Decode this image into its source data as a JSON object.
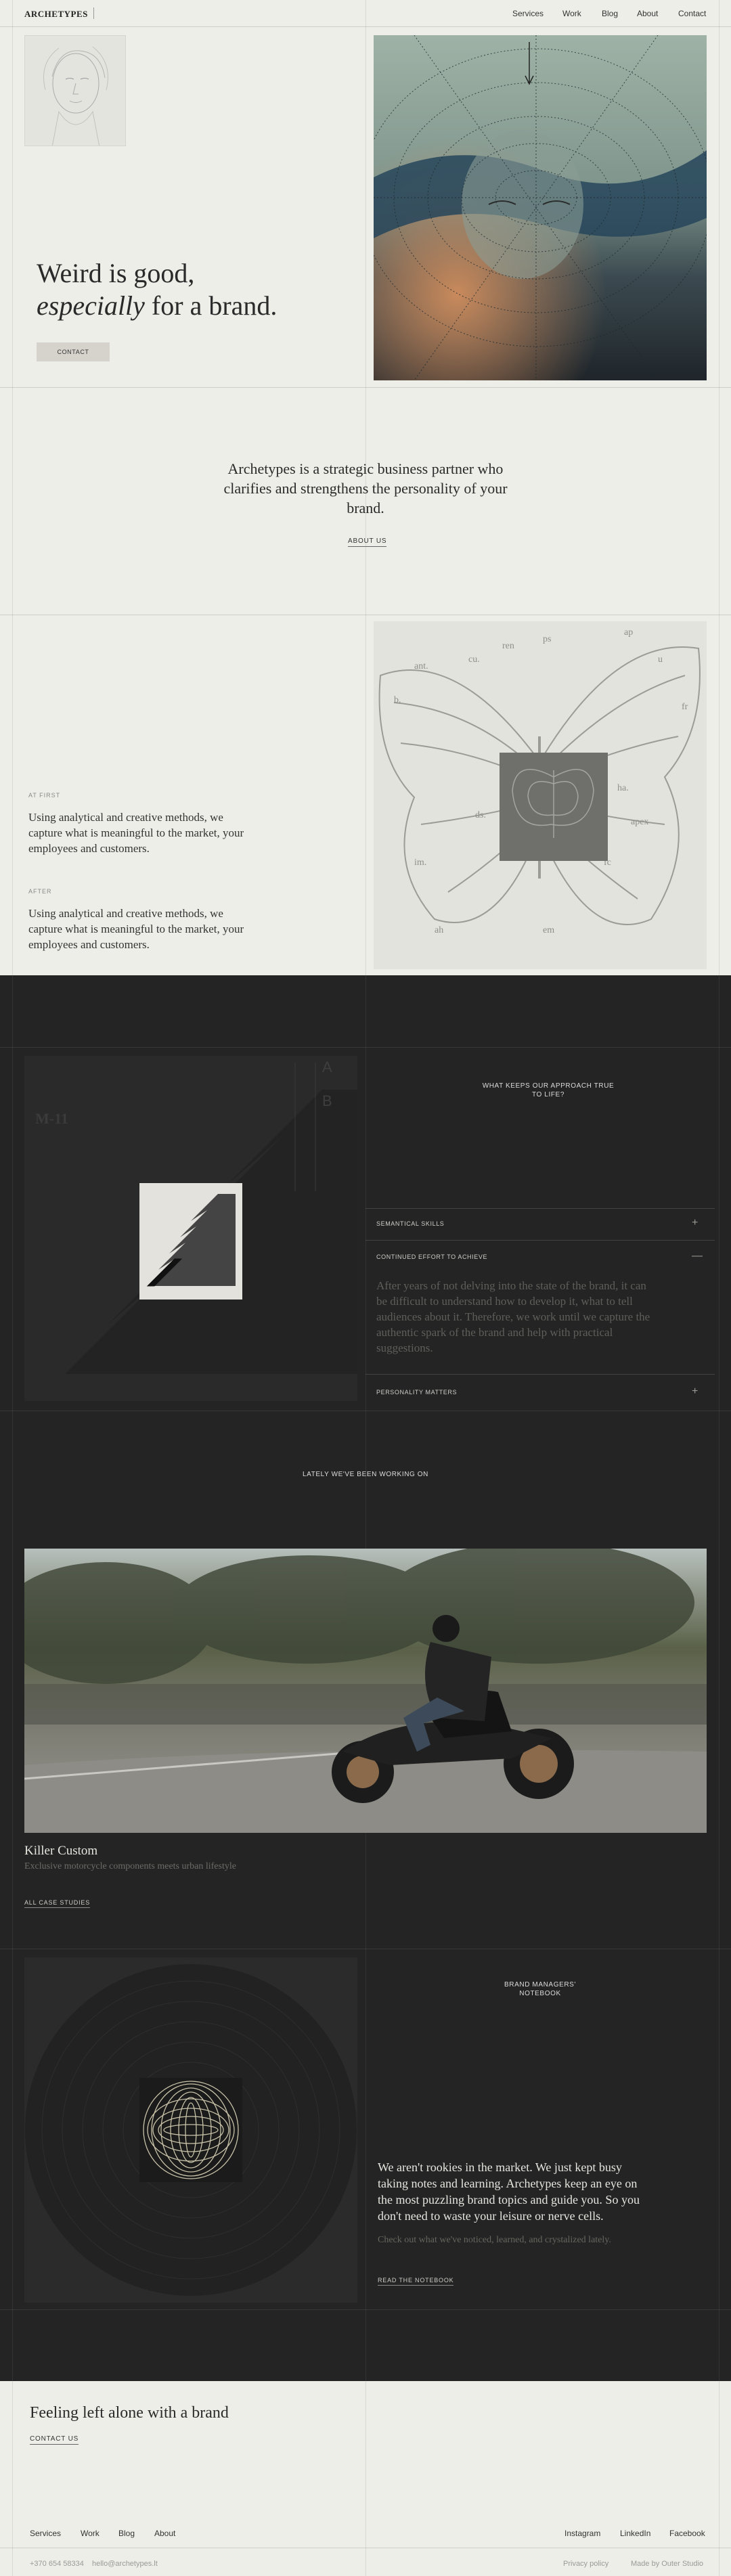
{
  "header": {
    "logo": "ARCHETYPES",
    "nav": [
      "Services",
      "Work",
      "Blog",
      "About",
      "Contact"
    ]
  },
  "hero": {
    "title_line1": "Weird is good,",
    "title_em": "especially",
    "title_rest": " for a brand.",
    "cta": "CONTACT"
  },
  "statement": {
    "text": "Archetypes is a strategic business partner who  clarifies and strengthens the personality of your brand.",
    "link": "ABOUT US"
  },
  "compare": {
    "first_label": "AT FIRST",
    "first_text": "Using analytical and creative methods, we capture what is meaningful to the market, your employees and customers.",
    "after_label": "AFTER",
    "after_text": "Using analytical and creative methods, we capture what is meaningful to the market, your employees and customers."
  },
  "approach": {
    "title": "WHAT KEEPS OUR APPROACH TRUE TO LIFE?",
    "items": [
      {
        "label": "SEMANTICAL SKILLS",
        "icon": "+"
      },
      {
        "label": "CONTINUED EFFORT TO ACHIEVE",
        "icon": "—",
        "text": "After years of not delving into the state of the brand, it can be difficult to understand how to develop it, what to tell audiences about it. Therefore, we work until we capture the authentic spark of the brand and help with practical suggestions."
      },
      {
        "label": "PERSONALITY MATTERS",
        "icon": "+"
      }
    ]
  },
  "work": {
    "title": "LATELY WE'VE BEEN WORKING ON",
    "case_title": "Killer Custom",
    "case_sub": "Exclusive motorcycle components meets urban lifestyle",
    "link": "ALL CASE STUDIES"
  },
  "notebook": {
    "title": "BRAND MANAGERS' NOTEBOOK",
    "text": "We aren't rookies in the market. We just kept busy taking notes and learning. Archetypes keep an eye on the most puzzling brand topics and guide you. So you don't need to waste your leisure or nerve cells.",
    "sub": "Check out what we've noticed, learned, and crystalized lately.",
    "link": "READ THE NOTEBOOK"
  },
  "footer": {
    "title": "Feeling left alone with a brand",
    "link": "CONTACT US",
    "nav": [
      "Services",
      "Work",
      "Blog",
      "About"
    ],
    "social": [
      "Instagram",
      "LinkedIn",
      "Facebook"
    ],
    "phone": "+370 654 58334",
    "email": "hello@archetypes.lt",
    "privacy": "Privacy policy",
    "made_by": "Made by Outer Studio"
  }
}
